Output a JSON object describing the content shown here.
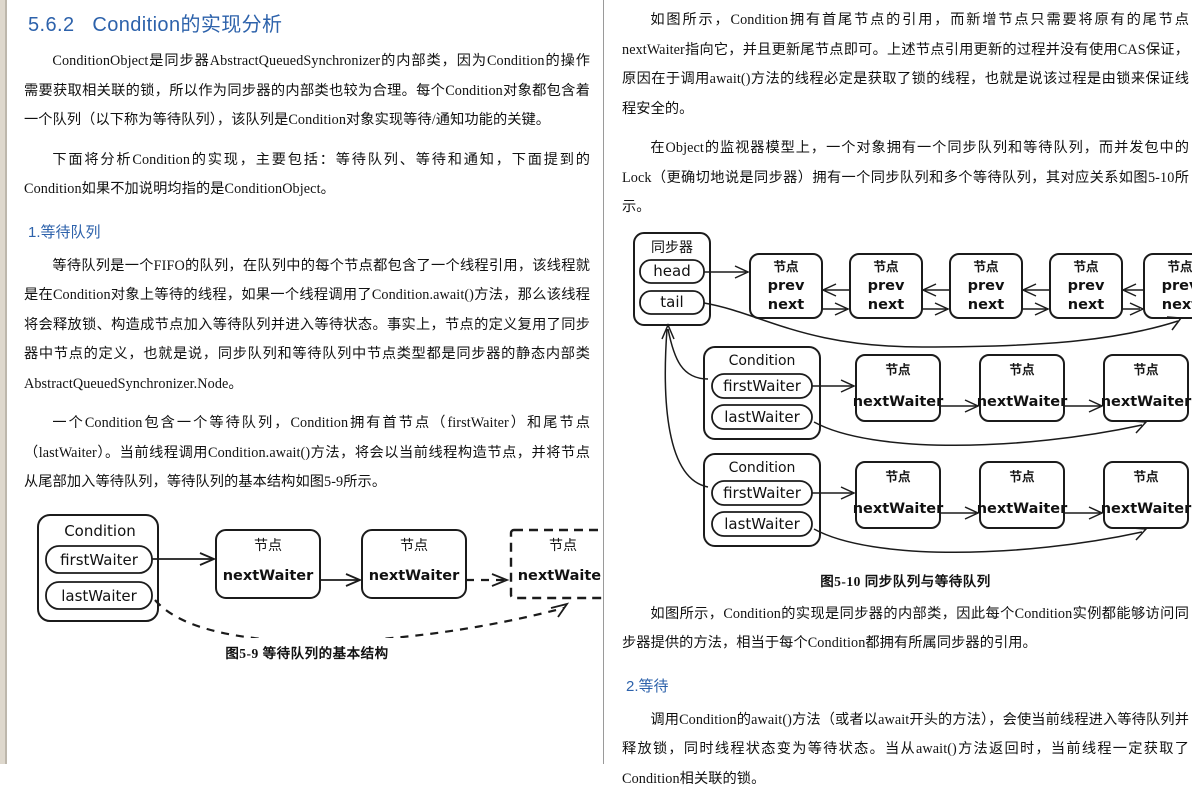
{
  "document": {
    "left_column": {
      "section_number": "5.6.2",
      "section_title": "Condition的实现分析",
      "paragraph_1": "ConditionObject是同步器AbstractQueuedSynchronizer的内部类，因为Condition的操作需要获取相关联的锁，所以作为同步器的内部类也较为合理。每个Condition对象都包含着一个队列（以下称为等待队列），该队列是Condition对象实现等待/通知功能的关键。",
      "paragraph_2": "下面将分析Condition的实现，主要包括：等待队列、等待和通知，下面提到的Condition如果不加说明均指的是ConditionObject。",
      "subsection_1_title": "1.等待队列",
      "paragraph_3": "等待队列是一个FIFO的队列，在队列中的每个节点都包含了一个线程引用，该线程就是在Condition对象上等待的线程，如果一个线程调用了Condition.await()方法，那么该线程将会释放锁、构造成节点加入等待队列并进入等待状态。事实上，节点的定义复用了同步器中节点的定义，也就是说，同步队列和等待队列中节点类型都是同步器的静态内部类AbstractQueuedSynchronizer.Node。",
      "paragraph_4": "一个Condition包含一个等待队列，Condition拥有首节点（firstWaiter）和尾节点（lastWaiter）。当前线程调用Condition.await()方法，将会以当前线程构造节点，并将节点从尾部加入等待队列，等待队列的基本结构如图5-9所示。",
      "figure_5_9": {
        "caption": "图5-9  等待队列的基本结构",
        "condition_box": {
          "title": "Condition",
          "fields": [
            "firstWaiter",
            "lastWaiter"
          ]
        },
        "nodes": [
          {
            "title": "节点",
            "field": "nextWaiter",
            "style": "solid"
          },
          {
            "title": "节点",
            "field": "nextWaiter",
            "style": "solid"
          },
          {
            "title": "节点",
            "field": "nextWaiter",
            "style": "dashed"
          }
        ]
      }
    },
    "right_column": {
      "paragraph_5": "如图所示，Condition拥有首尾节点的引用，而新增节点只需要将原有的尾节点nextWaiter指向它，并且更新尾节点即可。上述节点引用更新的过程并没有使用CAS保证，原因在于调用await()方法的线程必定是获取了锁的线程，也就是说该过程是由锁来保证线程安全的。",
      "paragraph_6": "在Object的监视器模型上，一个对象拥有一个同步队列和等待队列，而并发包中的Lock（更确切地说是同步器）拥有一个同步队列和多个等待队列，其对应关系如图5-10所示。",
      "figure_5_10": {
        "caption": "图5-10  同步队列与等待队列",
        "synchronizer_box": {
          "title": "同步器",
          "fields": [
            "head",
            "tail"
          ]
        },
        "sync_nodes": [
          {
            "title": "节点",
            "fields": [
              "prev",
              "next"
            ]
          },
          {
            "title": "节点",
            "fields": [
              "prev",
              "next"
            ]
          },
          {
            "title": "节点",
            "fields": [
              "prev",
              "next"
            ]
          },
          {
            "title": "节点",
            "fields": [
              "prev",
              "next"
            ]
          },
          {
            "title": "节点",
            "fields": [
              "prev",
              "next"
            ]
          }
        ],
        "condition_boxes": [
          {
            "title": "Condition",
            "fields": [
              "firstWaiter",
              "lastWaiter"
            ],
            "wait_nodes": [
              {
                "title": "节点",
                "field": "nextWaiter"
              },
              {
                "title": "节点",
                "field": "nextWaiter"
              },
              {
                "title": "节点",
                "field": "nextWaiter"
              }
            ]
          },
          {
            "title": "Condition",
            "fields": [
              "firstWaiter",
              "lastWaiter"
            ],
            "wait_nodes": [
              {
                "title": "节点",
                "field": "nextWaiter"
              },
              {
                "title": "节点",
                "field": "nextWaiter"
              },
              {
                "title": "节点",
                "field": "nextWaiter"
              }
            ]
          }
        ]
      },
      "paragraph_7": "如图所示，Condition的实现是同步器的内部类，因此每个Condition实例都能够访问同步器提供的方法，相当于每个Condition都拥有所属同步器的引用。",
      "subsection_2_title": "2.等待",
      "paragraph_8": "调用Condition的await()方法（或者以await开头的方法），会使当前线程进入等待队列并释放锁，同时线程状态变为等待状态。当从await()方法返回时，当前线程一定获取了Condition相关联的锁。"
    }
  },
  "colors": {
    "heading": "#2d62ab",
    "body_text": "#111111",
    "gutter": "#ded8cd",
    "divider": "#9a9a9a",
    "diagram_stroke": "#1b1b1b"
  }
}
